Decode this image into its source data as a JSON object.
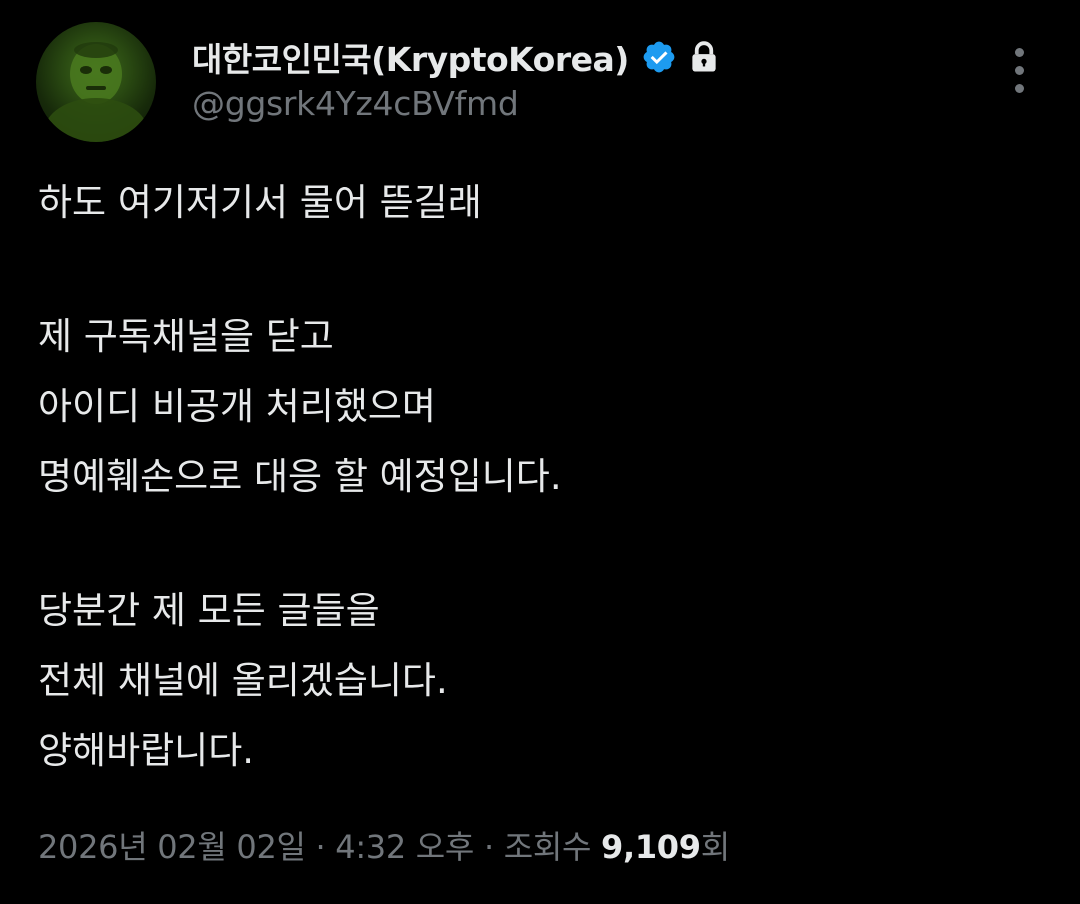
{
  "author": {
    "display_name": "대한코인민국(KryptoKorea)",
    "handle": "@ggsrk4Yz4cBVfmd",
    "verified": true,
    "protected": true,
    "avatar_icon": "avatar-image",
    "verified_color": "#1d9bf0"
  },
  "tweet": {
    "paragraph1": {
      "line1": "하도 여기저기서 물어 뜯길래"
    },
    "paragraph2": {
      "line1": "제 구독채널을 닫고",
      "line2": "아이디 비공개 처리했으며",
      "line3": "명예훼손으로 대응 할 예정입니다."
    },
    "paragraph3": {
      "line1": "당분간 제 모든 글들을",
      "line2": "전체 채널에 올리겠습니다.",
      "line3": "양해바랍니다."
    }
  },
  "meta": {
    "date": "2026년 02월 02일",
    "separator": " · ",
    "time": "4:32 오후",
    "views_label": "조회수",
    "views_count": "9,109",
    "views_suffix": "회"
  },
  "colors": {
    "background": "#000000",
    "primary_text": "#e7e9ea",
    "secondary_text": "#71767b",
    "accent": "#1d9bf0"
  }
}
